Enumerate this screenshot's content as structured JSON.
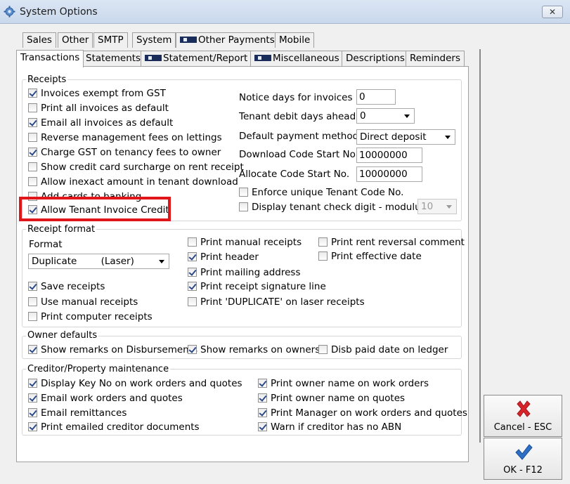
{
  "window": {
    "title": "System Options",
    "close_label": "✕"
  },
  "tabs_row1": [
    "Sales",
    "Other",
    "SMTP",
    "System",
    "Other Payments",
    "Mobile"
  ],
  "tabs_row2": [
    "Transactions",
    "Statements",
    "Statement/Report",
    "Miscellaneous",
    "Descriptions",
    "Reminders"
  ],
  "receipts": {
    "legend": "Receipts",
    "checkboxes": [
      {
        "label": "Invoices exempt from GST",
        "checked": true
      },
      {
        "label": "Print all invoices as default",
        "checked": false
      },
      {
        "label": "Email all invoices as default",
        "checked": true
      },
      {
        "label": "Reverse management fees on lettings",
        "checked": false
      },
      {
        "label": "Charge GST on tenancy fees to owner",
        "checked": true
      },
      {
        "label": "Show credit card surcharge on rent receipt",
        "checked": false
      },
      {
        "label": "Allow inexact amount in tenant download",
        "checked": false
      },
      {
        "label": "Add cards to banking",
        "checked": false
      },
      {
        "label": "Allow Tenant Invoice Credit",
        "checked": true
      }
    ],
    "notice_days_label": "Notice days for invoices",
    "notice_days_value": "0",
    "tenant_debit_label": "Tenant debit days ahead",
    "tenant_debit_value": "0",
    "payment_method_label": "Default payment method",
    "payment_method_value": "Direct deposit",
    "download_code_label": "Download Code Start No.",
    "download_code_value": "10000000",
    "allocate_code_label": "Allocate Code Start No.",
    "allocate_code_value": "10000000",
    "enforce_unique_label": "Enforce unique Tenant Code No.",
    "enforce_unique_checked": false,
    "check_digit_label": "Display tenant check digit - modulus",
    "check_digit_checked": false,
    "modulus_value": "10"
  },
  "receipt_format": {
    "legend": "Receipt format",
    "format_label": "Format",
    "format_value": "Duplicate        (Laser)",
    "left": [
      {
        "label": "Save receipts",
        "checked": true
      },
      {
        "label": "Use manual receipts",
        "checked": false
      },
      {
        "label": "Print computer receipts",
        "checked": false
      }
    ],
    "middle": [
      {
        "label": "Print manual receipts",
        "checked": false
      },
      {
        "label": "Print header",
        "checked": true
      },
      {
        "label": "Print mailing address",
        "checked": true
      },
      {
        "label": "Print receipt signature line",
        "checked": true
      },
      {
        "label": "Print 'DUPLICATE' on laser receipts",
        "checked": false
      }
    ],
    "right": [
      {
        "label": "Print rent reversal comment",
        "checked": false
      },
      {
        "label": "Print effective date",
        "checked": false
      }
    ]
  },
  "owner_defaults": {
    "legend": "Owner defaults",
    "items": [
      {
        "label": "Show remarks on Disbursements",
        "checked": true
      },
      {
        "label": "Show remarks on owners",
        "checked": true
      },
      {
        "label": "Disb paid date on ledger",
        "checked": false
      }
    ]
  },
  "creditor": {
    "legend": "Creditor/Property maintenance",
    "left": [
      {
        "label": "Display Key No on work orders and quotes",
        "checked": true
      },
      {
        "label": "Email work orders and quotes",
        "checked": true
      },
      {
        "label": "Email remittances",
        "checked": true
      },
      {
        "label": "Print emailed creditor documents",
        "checked": true
      }
    ],
    "right": [
      {
        "label": "Print owner name on work orders",
        "checked": true
      },
      {
        "label": "Print owner name on quotes",
        "checked": true
      },
      {
        "label": "Print Manager on work orders and quotes",
        "checked": true
      },
      {
        "label": "Warn if creditor has no ABN",
        "checked": true
      }
    ]
  },
  "buttons": {
    "cancel_label": "Cancel - ESC",
    "ok_label": "OK - F12"
  },
  "colors": {
    "highlight": "#e0161b",
    "cancel_icon": "#d8232a",
    "ok_icon": "#2d6fc4"
  }
}
